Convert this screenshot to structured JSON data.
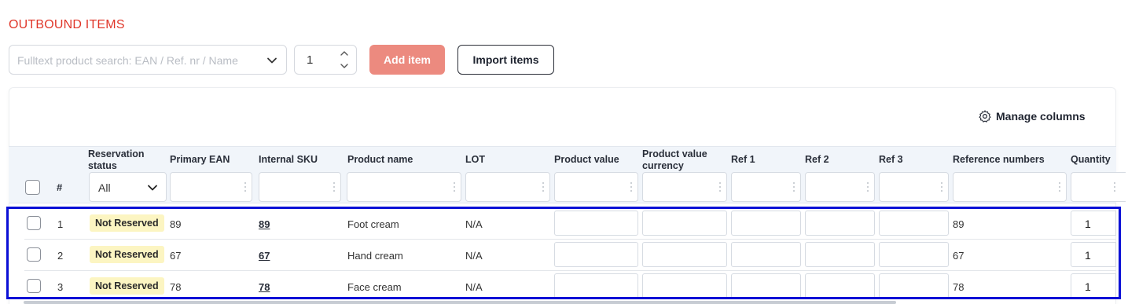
{
  "section": {
    "title": "OUTBOUND ITEMS"
  },
  "toolbar": {
    "search_placeholder": "Fulltext product search: EAN / Ref. nr / Name",
    "quantity_value": "1",
    "add_label": "Add item",
    "import_label": "Import items"
  },
  "table": {
    "manage_columns_label": "Manage columns",
    "headers": {
      "number": "#",
      "reservation_status_l1": "Reservation",
      "reservation_status_l2": "status",
      "primary_ean": "Primary EAN",
      "internal_sku": "Internal SKU",
      "product_name": "Product name",
      "lot": "LOT",
      "product_value": "Product value",
      "product_value_currency_l1": "Product value",
      "product_value_currency_l2": "currency",
      "ref1": "Ref 1",
      "ref2": "Ref 2",
      "ref3": "Ref 3",
      "reference_numbers": "Reference numbers",
      "quantity": "Quantity"
    },
    "filters": {
      "reservation_status_value": "All"
    },
    "rows": [
      {
        "index": "1",
        "status": "Not Reserved",
        "ean": "89",
        "sku": "89",
        "name": "Foot cream",
        "lot": "N/A",
        "reference_numbers": "89",
        "quantity": "1"
      },
      {
        "index": "2",
        "status": "Not Reserved",
        "ean": "67",
        "sku": "67",
        "name": "Hand cream",
        "lot": "N/A",
        "reference_numbers": "67",
        "quantity": "1"
      },
      {
        "index": "3",
        "status": "Not Reserved",
        "ean": "78",
        "sku": "78",
        "name": "Face cream",
        "lot": "N/A",
        "reference_numbers": "78",
        "quantity": "1"
      }
    ]
  },
  "colors": {
    "title_red": "#e0372a",
    "add_button_bg": "#ec8a7f",
    "badge_bg": "#fcf5c2",
    "highlight_border": "#0b10d6",
    "header_bg": "#f1f5fa"
  },
  "icons": {
    "search_dropdown": "chevron-down-icon",
    "stepper_up": "chevron-up-icon",
    "stepper_down": "chevron-down-icon",
    "manage_columns": "gear-icon",
    "filter_menu": "vertical-dots-icon"
  }
}
